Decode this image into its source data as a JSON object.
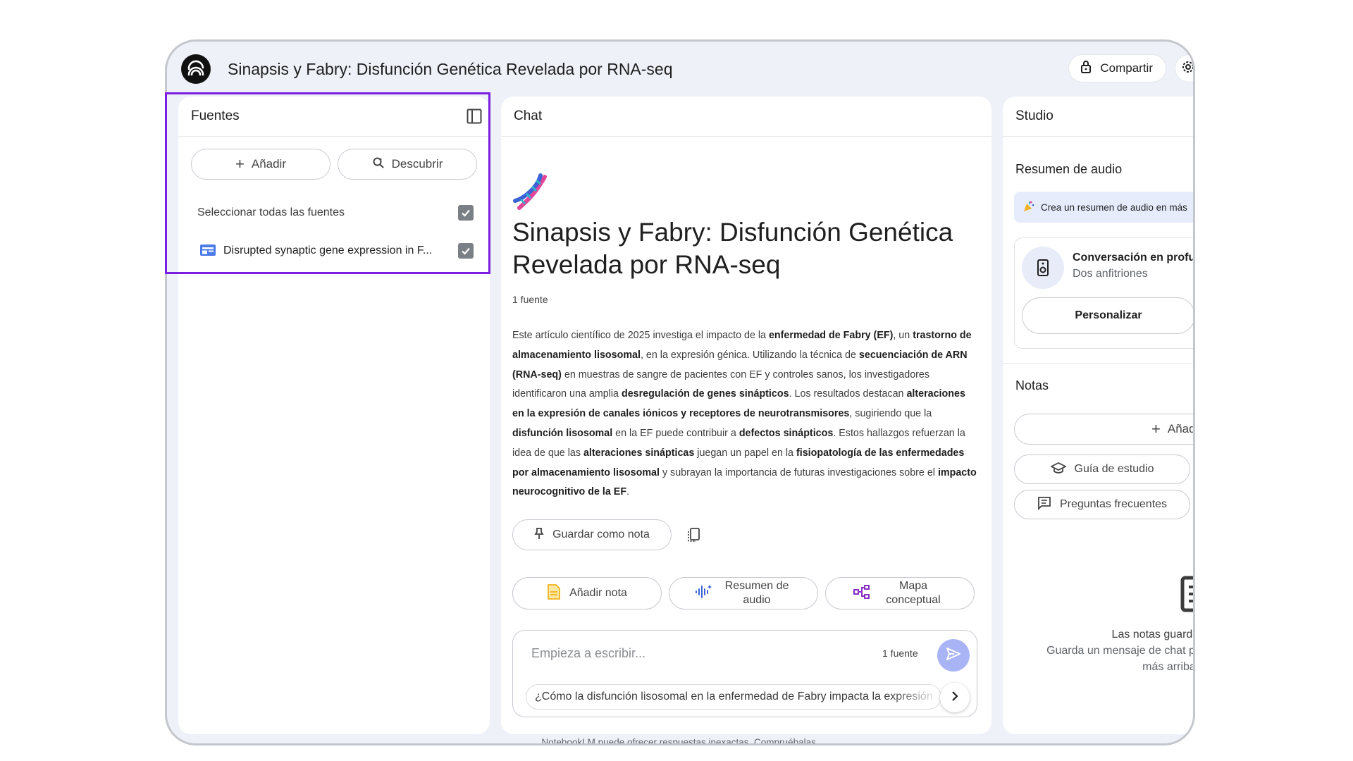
{
  "app": {
    "notebook_title": "Sinapsis y Fabry: Disfunción Genética Revelada por RNA-seq",
    "share_label": "Compartir"
  },
  "sources": {
    "title": "Fuentes",
    "add_label": "Añadir",
    "discover_label": "Descubrir",
    "select_all_label": "Seleccionar todas las fuentes",
    "items": [
      {
        "label": "Disrupted synaptic gene expression in F..."
      }
    ]
  },
  "chat": {
    "title": "Chat",
    "heading": "Sinapsis y Fabry: Disfunción Genética Revelada por RNA-seq",
    "source_count": "1 fuente",
    "summary_segments": [
      {
        "t": "Este artículo científico de 2025 investiga el impacto de la ",
        "b": false
      },
      {
        "t": "enfermedad de Fabry (EF)",
        "b": true
      },
      {
        "t": ", un ",
        "b": false
      },
      {
        "t": "trastorno de almacenamiento lisosomal",
        "b": true
      },
      {
        "t": ", en la expresión génica. Utilizando la técnica de ",
        "b": false
      },
      {
        "t": "secuenciación de ARN (RNA-seq)",
        "b": true
      },
      {
        "t": " en muestras de sangre de pacientes con EF y controles sanos, los investigadores identificaron una amplia ",
        "b": false
      },
      {
        "t": "desregulación de genes sinápticos",
        "b": true
      },
      {
        "t": ". Los resultados destacan ",
        "b": false
      },
      {
        "t": "alteraciones en la expresión de canales iónicos y receptores de neurotransmisores",
        "b": true
      },
      {
        "t": ", sugiriendo que la ",
        "b": false
      },
      {
        "t": "disfunción lisosomal",
        "b": true
      },
      {
        "t": " en la EF puede contribuir a ",
        "b": false
      },
      {
        "t": "defectos sinápticos",
        "b": true
      },
      {
        "t": ". Estos hallazgos refuerzan la idea de que las ",
        "b": false
      },
      {
        "t": "alteraciones sinápticas",
        "b": true
      },
      {
        "t": " juegan un papel en la ",
        "b": false
      },
      {
        "t": "fisiopatología de las enfermedades por almacenamiento lisosomal",
        "b": true
      },
      {
        "t": " y subrayan la importancia de futuras investigaciones sobre el ",
        "b": false
      },
      {
        "t": "impacto neurocognitivo de la EF",
        "b": true
      },
      {
        "t": ".",
        "b": false
      }
    ],
    "save_note_label": "Guardar como nota",
    "actions": {
      "add_note": "Añadir nota",
      "audio_summary": "Resumen de audio",
      "concept_map": "Mapa conceptual"
    },
    "composer": {
      "placeholder": "Empieza a escribir...",
      "source_count": "1 fuente",
      "suggestion": "¿Cómo la disfunción lisosomal en la enfermedad de Fabry impacta la expresión"
    },
    "footer": "NotebookLM puede ofrecer respuestas inexactas. Compruébalas."
  },
  "studio": {
    "title": "Studio",
    "audio_section": "Resumen de audio",
    "banner": "Crea un resumen de audio en más",
    "audio_card_title": "Conversación en profun",
    "audio_card_sub": "Dos anfitriones",
    "customize_label": "Personalizar",
    "notes_section": "Notas",
    "add_note_label": "Añadi",
    "study_guide_label": "Guía de estudio",
    "faq_label": "Preguntas frecuentes",
    "empty_title": "Las notas guardada",
    "empty_line1": "Guarda un mensaje de chat para",
    "empty_line2": "más arriba en"
  },
  "colors": {
    "highlight": "#7b1fe0",
    "send_button": "#a9b4f6",
    "frame_bg": "#eef1f8",
    "banner_bg": "#e6ecfb"
  }
}
